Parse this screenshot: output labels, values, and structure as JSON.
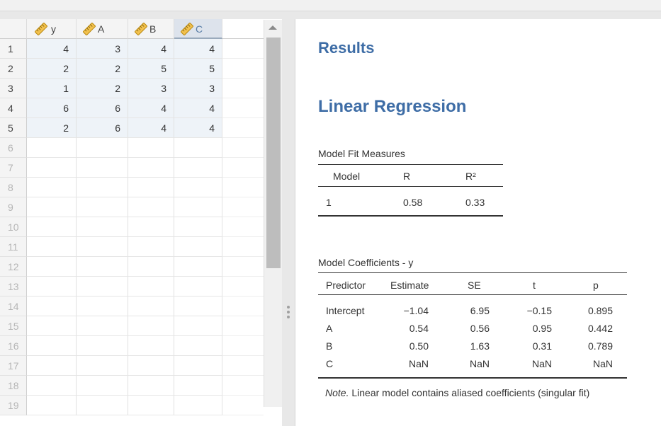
{
  "spreadsheet": {
    "columns": [
      {
        "name": "y",
        "selected": false
      },
      {
        "name": "A",
        "selected": false
      },
      {
        "name": "B",
        "selected": false
      },
      {
        "name": "C",
        "selected": true
      }
    ],
    "row_numbers": [
      "1",
      "2",
      "3",
      "4",
      "5",
      "6",
      "7",
      "8",
      "9",
      "10",
      "11",
      "12",
      "13",
      "14",
      "15",
      "16",
      "17",
      "18",
      "19"
    ],
    "rows": [
      [
        "4",
        "3",
        "4",
        "4"
      ],
      [
        "2",
        "2",
        "5",
        "5"
      ],
      [
        "1",
        "2",
        "3",
        "3"
      ],
      [
        "6",
        "6",
        "4",
        "4"
      ],
      [
        "2",
        "6",
        "4",
        "4"
      ]
    ],
    "column_icon": "ruler-icon",
    "colors": {
      "filled_cell": "#eef3f8",
      "accent": "#3e6da6"
    }
  },
  "results": {
    "title": "Results",
    "analysis_title": "Linear Regression",
    "model_fit": {
      "title": "Model Fit Measures",
      "headers": [
        "Model",
        "R",
        "R²"
      ],
      "rows": [
        [
          "1",
          "0.58",
          "0.33"
        ]
      ]
    },
    "coefficients": {
      "title": "Model Coefficients - y",
      "headers": [
        "Predictor",
        "Estimate",
        "SE",
        "t",
        "p"
      ],
      "rows": [
        [
          "Intercept",
          "−1.04",
          "6.95",
          "−0.15",
          "0.895"
        ],
        [
          "A",
          "0.54",
          "0.56",
          "0.95",
          "0.442"
        ],
        [
          "B",
          "0.50",
          "1.63",
          "0.31",
          "0.789"
        ],
        [
          "C",
          "NaN",
          "NaN",
          "NaN",
          "NaN"
        ]
      ],
      "note_label": "Note.",
      "note_text": " Linear model contains aliased coefficients (singular fit)"
    }
  }
}
